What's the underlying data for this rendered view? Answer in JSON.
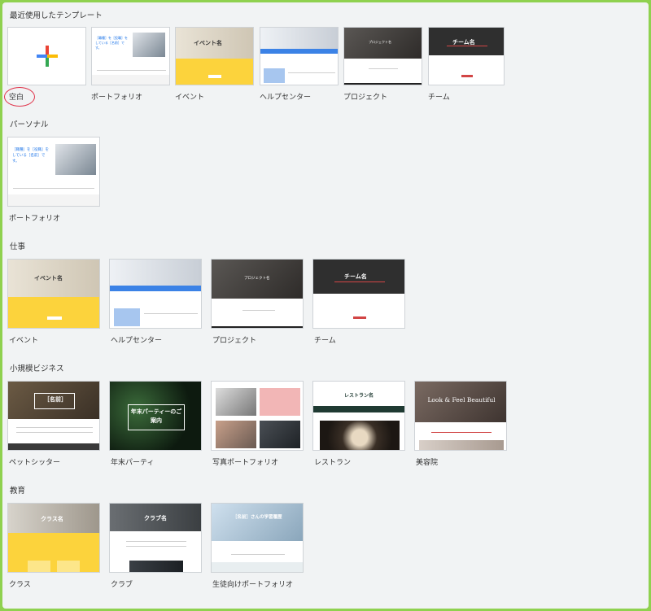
{
  "colors": {
    "outer_border": "#8fd14f",
    "background": "#f1f3f4",
    "highlight_circle": "#e0344b",
    "accent_yellow": "#fcd33c",
    "accent_blue": "#3b82e6",
    "accent_red": "#d24545"
  },
  "sections": [
    {
      "title": "最近使用したテンプレート",
      "templates": [
        {
          "label": "空白",
          "thumb_text": ""
        },
        {
          "label": "ポートフォリオ",
          "thumb_text": "［職種］を［役職］をしている［名前］です。"
        },
        {
          "label": "イベント",
          "thumb_text": "イベント名"
        },
        {
          "label": "ヘルプセンター",
          "thumb_text": ""
        },
        {
          "label": "プロジェクト",
          "thumb_text": "プロジェクト名"
        },
        {
          "label": "チーム",
          "thumb_text": "チーム名"
        }
      ]
    },
    {
      "title": "パーソナル",
      "templates": [
        {
          "label": "ポートフォリオ",
          "thumb_text": "［職種］を［役職］をしている［名前］です。"
        }
      ]
    },
    {
      "title": "仕事",
      "templates": [
        {
          "label": "イベント",
          "thumb_text": "イベント名"
        },
        {
          "label": "ヘルプセンター",
          "thumb_text": ""
        },
        {
          "label": "プロジェクト",
          "thumb_text": "プロジェクト名"
        },
        {
          "label": "チーム",
          "thumb_text": "チーム名"
        }
      ]
    },
    {
      "title": "小規模ビジネス",
      "templates": [
        {
          "label": "ペットシッター",
          "thumb_text": "［名前］"
        },
        {
          "label": "年末パーティ",
          "thumb_text": "年末パーティーのご案内"
        },
        {
          "label": "写真ポートフォリオ",
          "thumb_text": ""
        },
        {
          "label": "レストラン",
          "thumb_text": "レストラン名"
        },
        {
          "label": "美容院",
          "thumb_text": "Look & Feel Beautiful"
        }
      ]
    },
    {
      "title": "教育",
      "templates": [
        {
          "label": "クラス",
          "thumb_text": "クラス名"
        },
        {
          "label": "クラブ",
          "thumb_text": "クラブ名"
        },
        {
          "label": "生徒向けポートフォリオ",
          "thumb_text": "［名前］さんの学習履歴"
        }
      ]
    }
  ]
}
